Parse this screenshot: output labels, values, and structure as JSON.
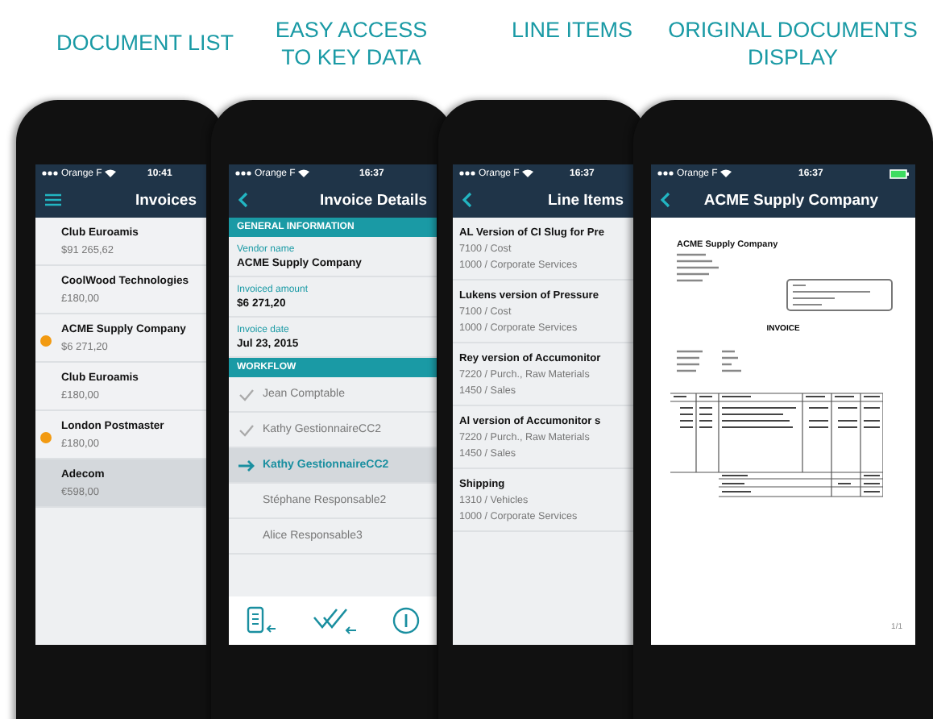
{
  "captions": [
    "DOCUMENT LIST",
    "EASY ACCESS\nTO KEY DATA",
    "LINE ITEMS",
    "ORIGINAL DOCUMENTS\nDISPLAY"
  ],
  "document_list": {
    "carrier": "Orange F",
    "time": "10:41",
    "title": "Invoices",
    "items": [
      {
        "name": "Club Euroamis",
        "amount": "$91 265,62",
        "alert": false,
        "selected": false
      },
      {
        "name": "CoolWood Technologies",
        "amount": "£180,00",
        "alert": false,
        "selected": false
      },
      {
        "name": "ACME Supply Company",
        "amount": "$6 271,20",
        "alert": true,
        "selected": false
      },
      {
        "name": "Club Euroamis",
        "amount": "£180,00",
        "alert": false,
        "selected": false
      },
      {
        "name": "London Postmaster",
        "amount": "£180,00",
        "alert": true,
        "selected": false
      },
      {
        "name": "Adecom",
        "amount": "€598,00",
        "alert": false,
        "selected": true
      }
    ]
  },
  "invoice_details": {
    "carrier": "Orange F",
    "time": "16:37",
    "title": "Invoice Details",
    "general_header": "GENERAL INFORMATION",
    "fields": [
      {
        "label": "Vendor name",
        "value": "ACME Supply Company"
      },
      {
        "label": "Invoiced amount",
        "value": "$6 271,20"
      },
      {
        "label": "Invoice date",
        "value": "Jul 23, 2015"
      }
    ],
    "workflow_header": "WORKFLOW",
    "steps": [
      {
        "name": "Jean Comptable",
        "kind": "done",
        "selected": false
      },
      {
        "name": "Kathy GestionnaireCC2",
        "kind": "done",
        "selected": false
      },
      {
        "name": "Kathy GestionnaireCC2",
        "kind": "current",
        "selected": true
      },
      {
        "name": "Stéphane Responsable2",
        "kind": "pending",
        "selected": false
      },
      {
        "name": "Alice Responsable3",
        "kind": "pending",
        "selected": false
      }
    ]
  },
  "line_items": {
    "carrier": "Orange F",
    "time": "16:37",
    "title": "Line Items",
    "items": [
      {
        "title": "AL Version of CI Slug for Pre",
        "account": "7100 / Cost",
        "department": "1000 / Corporate Services"
      },
      {
        "title": "Lukens version of Pressure",
        "account": "7100 / Cost",
        "department": "1000 / Corporate Services"
      },
      {
        "title": "Rey version of Accumonitor",
        "account": "7220 / Purch., Raw Materials",
        "department": "1450 / Sales"
      },
      {
        "title": "Al version of Accumonitor s",
        "account": "7220 / Purch., Raw Materials",
        "department": "1450 / Sales"
      },
      {
        "title": "Shipping",
        "account": "1310 / Vehicles",
        "department": "1000 / Corporate Services"
      }
    ]
  },
  "document_display": {
    "carrier": "Orange F",
    "time": "16:37",
    "title": "ACME Supply Company",
    "document": {
      "company": "ACME Supply Company",
      "heading": "INVOICE",
      "page": "1/1"
    }
  }
}
